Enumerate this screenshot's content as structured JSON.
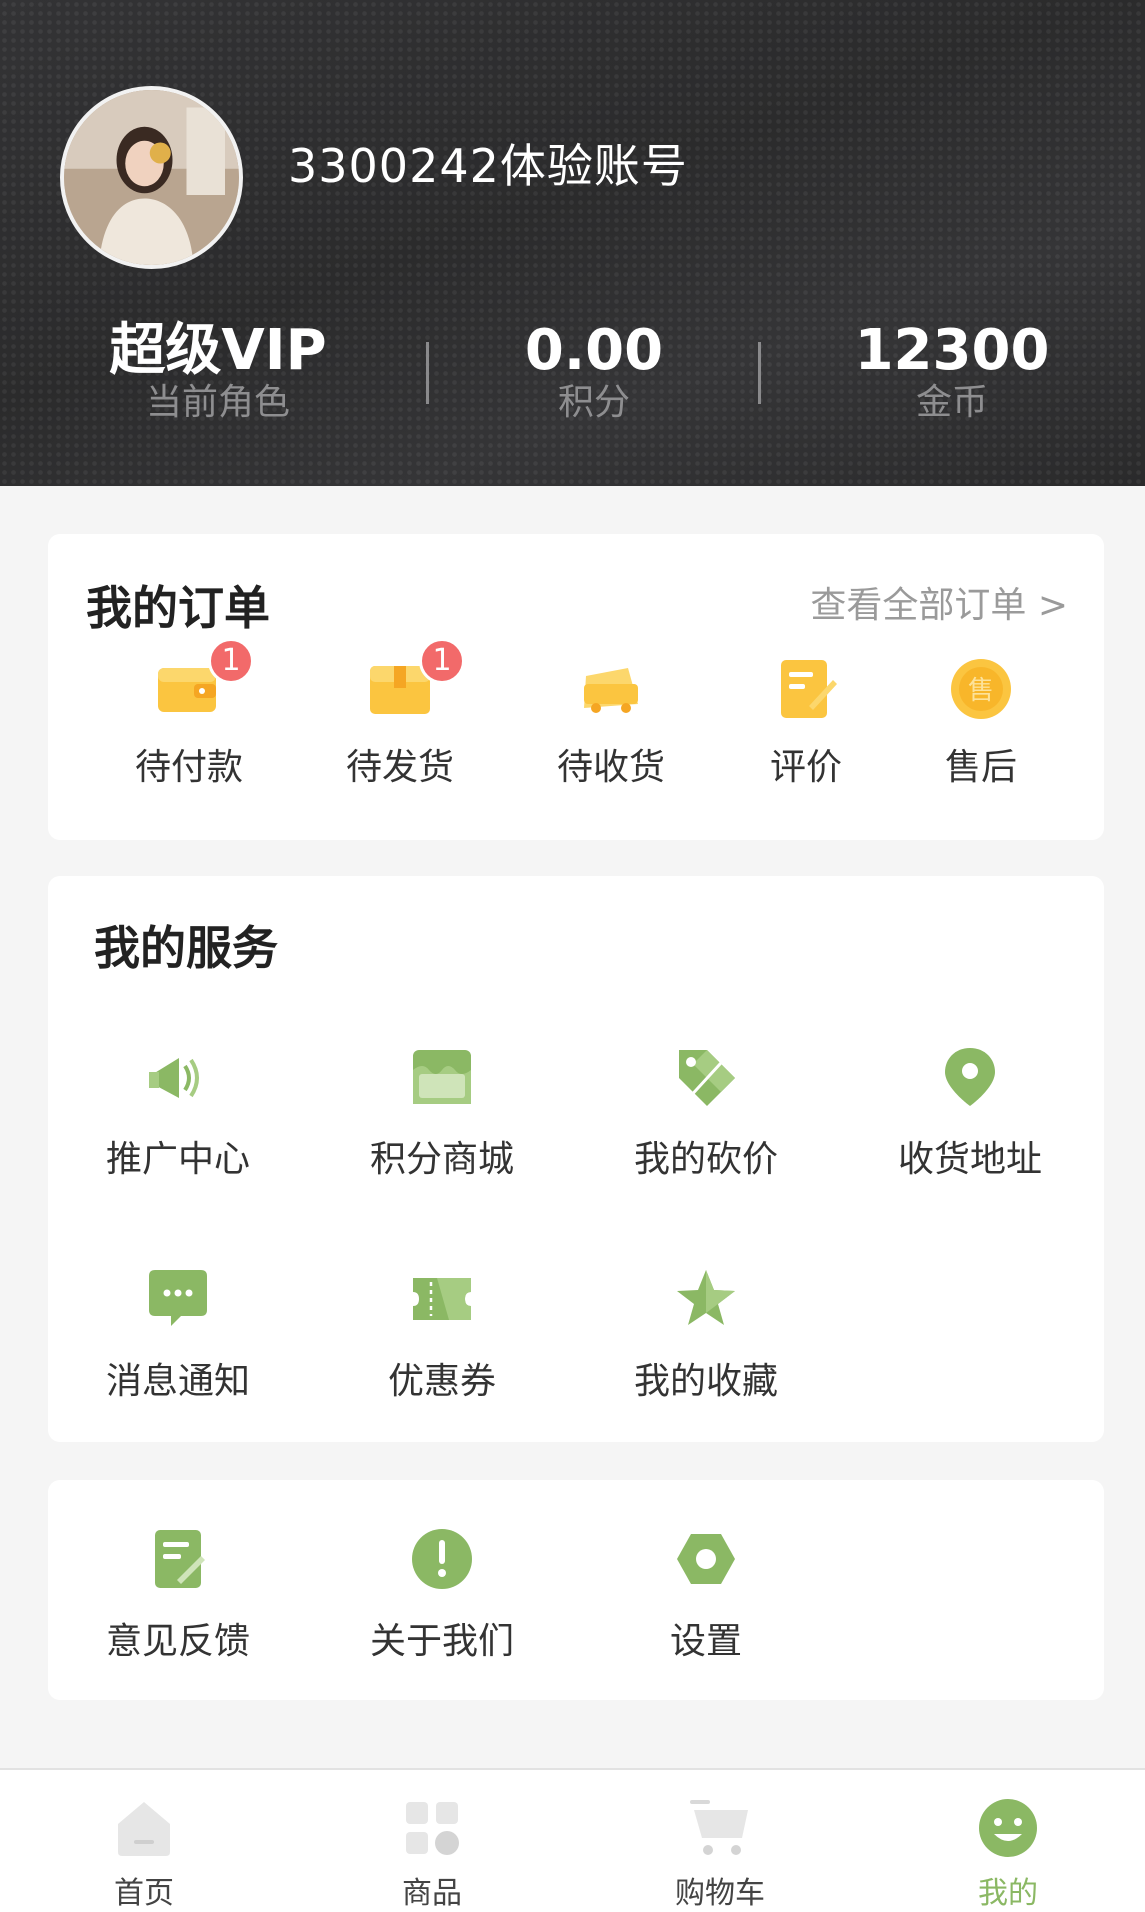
{
  "profile": {
    "username": "3300242体验账号",
    "stats": [
      {
        "value": "超级VIP",
        "label": "当前角色"
      },
      {
        "value": "0.00",
        "label": "积分"
      },
      {
        "value": "12300",
        "label": "金币"
      }
    ]
  },
  "orders": {
    "title": "我的订单",
    "view_all": "查看全部订单 >",
    "items": [
      {
        "label": "待付款",
        "icon": "wallet-icon",
        "badge": "1"
      },
      {
        "label": "待发货",
        "icon": "package-icon",
        "badge": "1"
      },
      {
        "label": "待收货",
        "icon": "truck-icon"
      },
      {
        "label": "评价",
        "icon": "review-icon"
      },
      {
        "label": "售后",
        "icon": "after-sale-icon",
        "icon_text": "售"
      }
    ]
  },
  "services": {
    "title": "我的服务",
    "items": [
      {
        "label": "推广中心",
        "icon": "megaphone-icon"
      },
      {
        "label": "积分商城",
        "icon": "shop-icon"
      },
      {
        "label": "我的砍价",
        "icon": "price-tag-icon"
      },
      {
        "label": "收货地址",
        "icon": "location-pin-icon"
      },
      {
        "label": "消息通知",
        "icon": "message-icon"
      },
      {
        "label": "优惠券",
        "icon": "coupon-icon"
      },
      {
        "label": "我的收藏",
        "icon": "star-icon"
      }
    ]
  },
  "misc": {
    "items": [
      {
        "label": "意见反馈",
        "icon": "feedback-icon"
      },
      {
        "label": "关于我们",
        "icon": "info-icon"
      },
      {
        "label": "设置",
        "icon": "settings-icon"
      }
    ]
  },
  "tabbar": {
    "items": [
      {
        "label": "首页",
        "icon": "home-icon"
      },
      {
        "label": "商品",
        "icon": "grid-icon"
      },
      {
        "label": "购物车",
        "icon": "cart-icon"
      },
      {
        "label": "我的",
        "icon": "profile-face-icon",
        "active": true
      }
    ]
  },
  "colors": {
    "header_bg": "#2f2f30",
    "accent_green": "#8bb864",
    "order_yellow": "#fbc540",
    "badge_red": "#f26a6a"
  }
}
